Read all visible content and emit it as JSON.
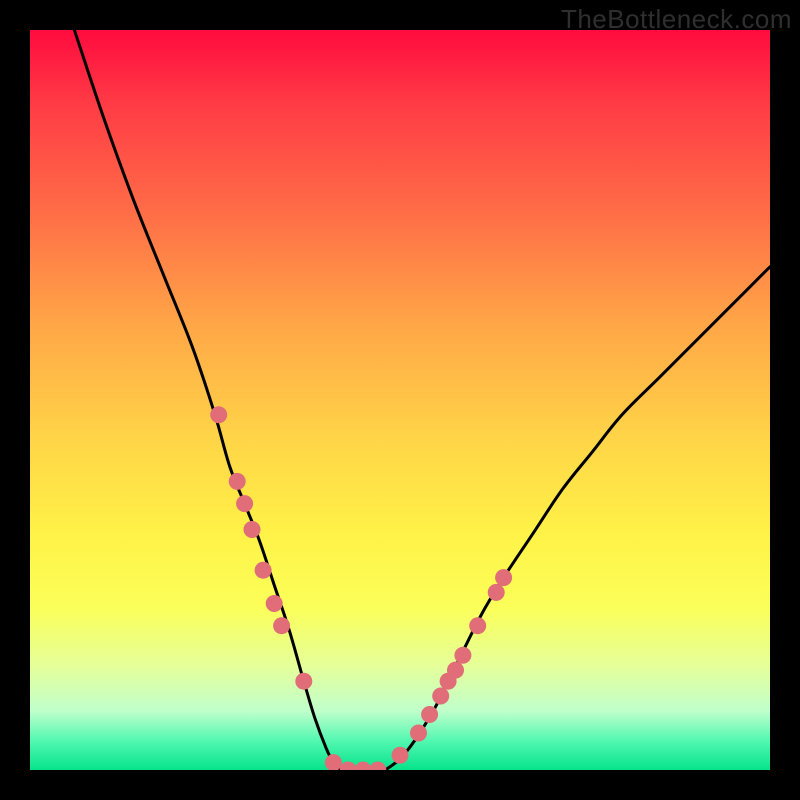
{
  "watermark": "TheBottleneck.com",
  "chart_data": {
    "type": "line",
    "title": "",
    "xlabel": "",
    "ylabel": "",
    "xlim": [
      0,
      100
    ],
    "ylim": [
      0,
      100
    ],
    "series": [
      {
        "name": "left-curve",
        "x": [
          6,
          10,
          14,
          18,
          22,
          25,
          27,
          29,
          31,
          33,
          35,
          37,
          38.5,
          40,
          41,
          42
        ],
        "y": [
          100,
          88,
          77,
          67,
          57,
          48,
          41,
          36,
          31,
          25,
          19,
          12,
          7,
          3,
          1,
          0
        ],
        "color": "#000000"
      },
      {
        "name": "right-curve",
        "x": [
          48,
          50,
          52,
          54.5,
          56,
          58,
          61,
          64,
          68,
          72,
          76,
          80,
          85,
          90,
          95,
          100
        ],
        "y": [
          0,
          1.5,
          4,
          8,
          11,
          15,
          21,
          26,
          32,
          38,
          43,
          48,
          53,
          58,
          63,
          68
        ],
        "color": "#000000"
      },
      {
        "name": "flat-bottom",
        "x": [
          42,
          48
        ],
        "y": [
          0,
          0
        ],
        "color": "#000000"
      }
    ],
    "markers": {
      "color": "#e06d78",
      "radius_px": 8.5,
      "points": [
        {
          "name": "l1",
          "x": 25.5,
          "y": 48
        },
        {
          "name": "l2",
          "x": 28,
          "y": 39
        },
        {
          "name": "l3",
          "x": 29,
          "y": 36
        },
        {
          "name": "l4",
          "x": 30,
          "y": 32.5
        },
        {
          "name": "l5",
          "x": 31.5,
          "y": 27
        },
        {
          "name": "l6",
          "x": 33,
          "y": 22.5
        },
        {
          "name": "l7",
          "x": 34,
          "y": 19.5
        },
        {
          "name": "l8",
          "x": 37,
          "y": 12
        },
        {
          "name": "b1",
          "x": 41,
          "y": 1
        },
        {
          "name": "b2",
          "x": 43,
          "y": 0
        },
        {
          "name": "b3",
          "x": 45,
          "y": 0
        },
        {
          "name": "b4",
          "x": 47,
          "y": 0
        },
        {
          "name": "r1",
          "x": 50,
          "y": 2
        },
        {
          "name": "r2",
          "x": 52.5,
          "y": 5
        },
        {
          "name": "r3",
          "x": 54,
          "y": 7.5
        },
        {
          "name": "r4",
          "x": 55.5,
          "y": 10
        },
        {
          "name": "r5",
          "x": 56.5,
          "y": 12
        },
        {
          "name": "r6",
          "x": 57.5,
          "y": 13.5
        },
        {
          "name": "r7",
          "x": 58.5,
          "y": 15.5
        },
        {
          "name": "r8",
          "x": 60.5,
          "y": 19.5
        },
        {
          "name": "r9",
          "x": 63,
          "y": 24
        },
        {
          "name": "r10",
          "x": 64,
          "y": 26
        }
      ]
    }
  }
}
